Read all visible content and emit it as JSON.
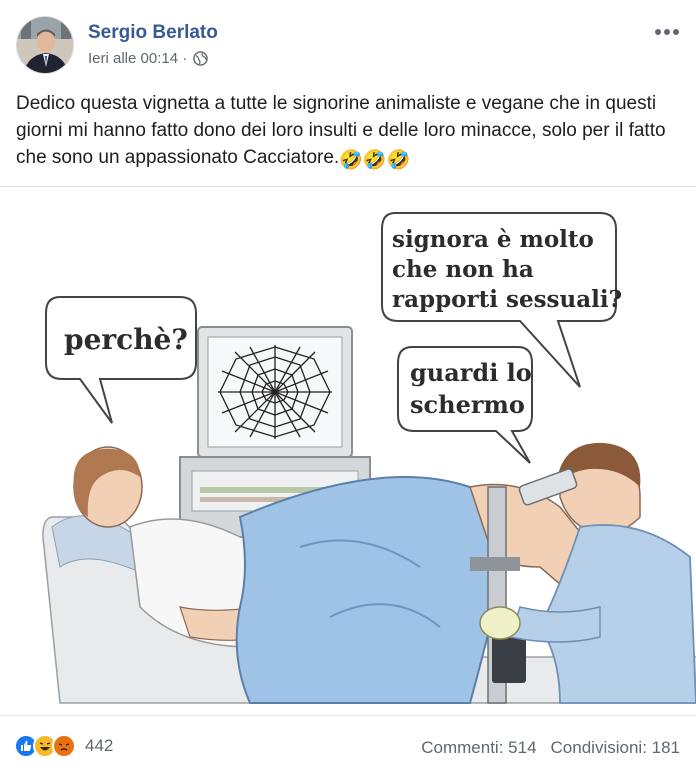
{
  "post": {
    "author": "Sergio Berlato",
    "time": "Ieri alle 00:14 ·",
    "more_icon": "more-options-icon",
    "text": "Dedico questa vignetta a tutte le signorine animaliste e vegane che in questi giorni mi hanno fatto dono dei loro insulti e delle loro minacce, solo per il fatto che sono un appassionato Cacciatore.",
    "text_emoji": "🤣🤣🤣"
  },
  "cartoon": {
    "bubble_patient": "perchè?",
    "bubble_doctor_line1": "signora è molto",
    "bubble_doctor_line2": "che non ha",
    "bubble_doctor_line3": "rapporti sessuali?",
    "bubble_screen_line1": "guardi lo",
    "bubble_screen_line2": "schermo"
  },
  "footer": {
    "reaction_count": "442",
    "comments": "Commenti: 514",
    "shares": "Condivisioni: 181"
  },
  "colors": {
    "link_blue": "#385898",
    "like_blue": "#1877f2",
    "haha_yellow": "#f7b928",
    "angry_orange": "#e9710f",
    "gown_blue": "#9fc3e6"
  }
}
